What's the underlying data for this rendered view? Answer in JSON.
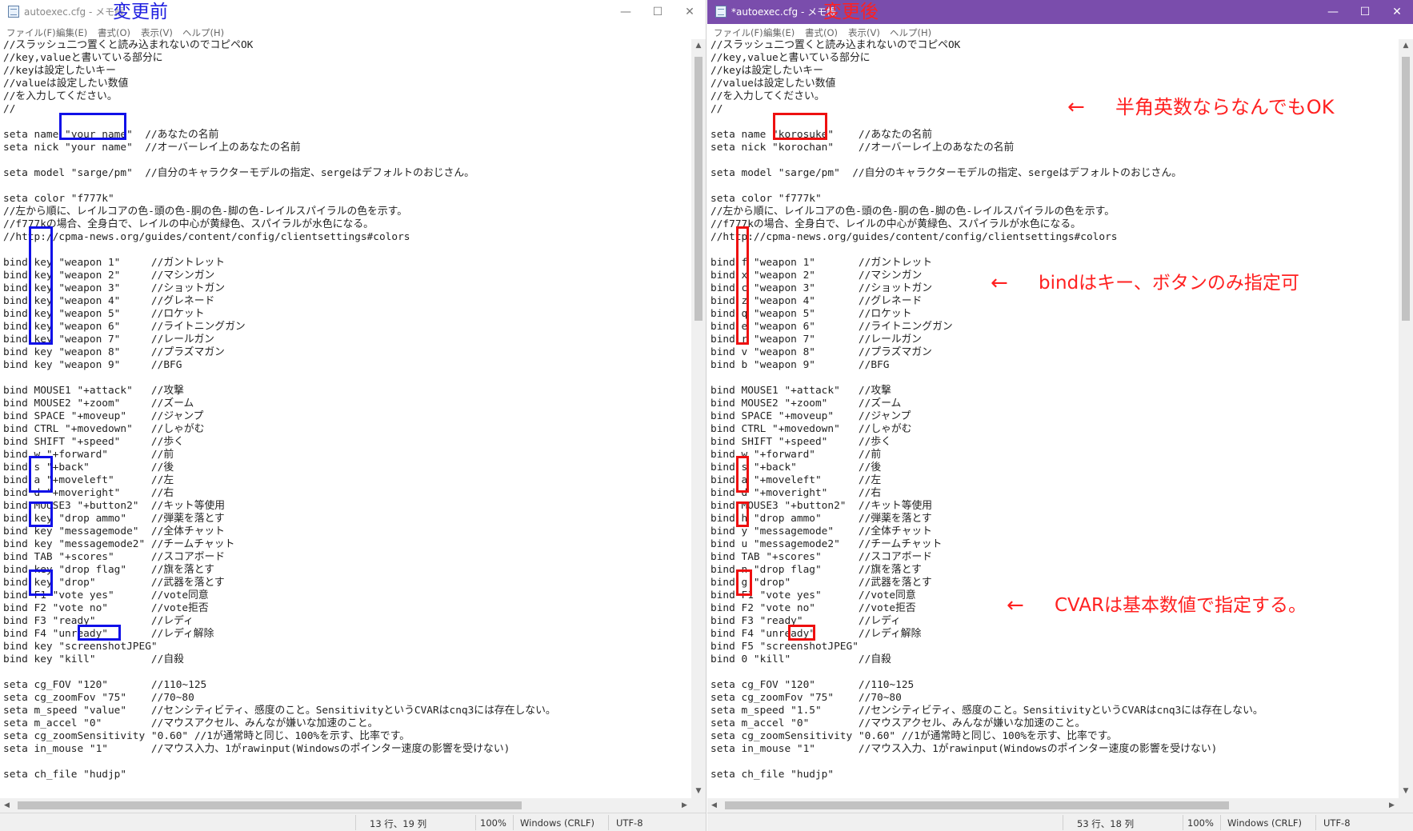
{
  "left_window": {
    "title": "autoexec.cfg - メモ帳",
    "label": "変更前",
    "menu": [
      "ファイル(F)",
      "編集(E)",
      "書式(O)",
      "表示(V)",
      "ヘルプ(H)"
    ],
    "lines": [
      "//スラッシュ二つ置くと読み込まれないのでコピペOK",
      "//key,valueと書いている部分に",
      "//keyは設定したいキー",
      "//valueは設定したい数値",
      "//を入力してください。",
      "//",
      "",
      "seta name \"your name\"  //あなたの名前",
      "seta nick \"your name\"  //オーバーレイ上のあなたの名前",
      "",
      "seta model \"sarge/pm\"  //自分のキャラクターモデルの指定、sergeはデフォルトのおじさん。",
      "",
      "seta color \"f777k\"",
      "//左から順に、レイルコアの色-頭の色-胴の色-脚の色-レイルスパイラルの色を示す。",
      "//f777kの場合、全身白で、レイルの中心が黄緑色、スパイラルが水色になる。",
      "//http://cpma-news.org/guides/content/config/clientsettings#colors",
      "",
      "bind key \"weapon 1\"     //ガントレット",
      "bind key \"weapon 2\"     //マシンガン",
      "bind key \"weapon 3\"     //ショットガン",
      "bind key \"weapon 4\"     //グレネード",
      "bind key \"weapon 5\"     //ロケット",
      "bind key \"weapon 6\"     //ライトニングガン",
      "bind key \"weapon 7\"     //レールガン",
      "bind key \"weapon 8\"     //プラズマガン",
      "bind key \"weapon 9\"     //BFG",
      "",
      "bind MOUSE1 \"+attack\"   //攻撃",
      "bind MOUSE2 \"+zoom\"     //ズーム",
      "bind SPACE \"+moveup\"    //ジャンプ",
      "bind CTRL \"+movedown\"   //しゃがむ",
      "bind SHIFT \"+speed\"     //歩く",
      "bind w \"+forward\"       //前",
      "bind s \"+back\"          //後",
      "bind a \"+moveleft\"      //左",
      "bind d \"+moveright\"     //右",
      "bind MOUSE3 \"+button2\"  //キット等使用",
      "bind key \"drop ammo\"    //弾薬を落とす",
      "bind key \"messagemode\"  //全体チャット",
      "bind key \"messagemode2\" //チームチャット",
      "bind TAB \"+scores\"      //スコアボード",
      "bind key \"drop flag\"    //旗を落とす",
      "bind key \"drop\"         //武器を落とす",
      "bind F1 \"vote yes\"      //vote同意",
      "bind F2 \"vote no\"       //vote拒否",
      "bind F3 \"ready\"         //レディ",
      "bind F4 \"unready\"       //レディ解除",
      "bind key \"screenshotJPEG\"",
      "bind key \"kill\"         //自殺",
      "",
      "seta cg_FOV \"120\"       //110~125",
      "seta cg_zoomFov \"75\"    //70~80",
      "seta m_speed \"value\"    //センシティビティ、感度のこと。SensitivityというCVARはcnq3には存在しない。",
      "seta m_accel \"0\"        //マウスアクセル、みんなが嫌いな加速のこと。",
      "seta cg_zoomSensitivity \"0.60\" //1が通常時と同じ、100%を示す、比率です。",
      "seta in_mouse \"1\"       //マウス入力、1がrawinput(Windowsのポインター速度の影響を受けない)",
      "",
      "seta ch_file \"hudjp\""
    ],
    "status": {
      "position": "13 行、19 列",
      "zoom": "100%",
      "eol": "Windows (CRLF)",
      "encoding": "UTF-8"
    }
  },
  "right_window": {
    "title": "*autoexec.cfg - メモ帳",
    "label": "変更後",
    "menu": [
      "ファイル(F)",
      "編集(E)",
      "書式(O)",
      "表示(V)",
      "ヘルプ(H)"
    ],
    "lines": [
      "//スラッシュ二つ置くと読み込まれないのでコピペOK",
      "//key,valueと書いている部分に",
      "//keyは設定したいキー",
      "//valueは設定したい数値",
      "//を入力してください。",
      "//",
      "",
      "seta name \"korosuke\"    //あなたの名前",
      "seta nick \"korochan\"    //オーバーレイ上のあなたの名前",
      "",
      "seta model \"sarge/pm\"  //自分のキャラクターモデルの指定、sergeはデフォルトのおじさん。",
      "",
      "seta color \"f777k\"",
      "//左から順に、レイルコアの色-頭の色-胴の色-脚の色-レイルスパイラルの色を示す。",
      "//f777kの場合、全身白で、レイルの中心が黄緑色、スパイラルが水色になる。",
      "//http://cpma-news.org/guides/content/config/clientsettings#colors",
      "",
      "bind f \"weapon 1\"       //ガントレット",
      "bind x \"weapon 2\"       //マシンガン",
      "bind c \"weapon 3\"       //ショットガン",
      "bind z \"weapon 4\"       //グレネード",
      "bind q \"weapon 5\"       //ロケット",
      "bind e \"weapon 6\"       //ライトニングガン",
      "bind r \"weapon 7\"       //レールガン",
      "bind v \"weapon 8\"       //プラズマガン",
      "bind b \"weapon 9\"       //BFG",
      "",
      "bind MOUSE1 \"+attack\"   //攻撃",
      "bind MOUSE2 \"+zoom\"     //ズーム",
      "bind SPACE \"+moveup\"    //ジャンプ",
      "bind CTRL \"+movedown\"   //しゃがむ",
      "bind SHIFT \"+speed\"     //歩く",
      "bind w \"+forward\"       //前",
      "bind s \"+back\"          //後",
      "bind a \"+moveleft\"      //左",
      "bind d \"+moveright\"     //右",
      "bind MOUSE3 \"+button2\"  //キット等使用",
      "bind h \"drop ammo\"      //弾薬を落とす",
      "bind y \"messagemode\"    //全体チャット",
      "bind u \"messagemode2\"   //チームチャット",
      "bind TAB \"+scores\"      //スコアボード",
      "bind n \"drop flag\"      //旗を落とす",
      "bind g \"drop\"           //武器を落とす",
      "bind F1 \"vote yes\"      //vote同意",
      "bind F2 \"vote no\"       //vote拒否",
      "bind F3 \"ready\"         //レディ",
      "bind F4 \"unready\"       //レディ解除",
      "bind F5 \"screenshotJPEG\"",
      "bind 0 \"kill\"           //自殺",
      "",
      "seta cg_FOV \"120\"       //110~125",
      "seta cg_zoomFov \"75\"    //70~80",
      "seta m_speed \"1.5\"      //センシティビティ、感度のこと。SensitivityというCVARはcnq3には存在しない。",
      "seta m_accel \"0\"        //マウスアクセル、みんなが嫌いな加速のこと。",
      "seta cg_zoomSensitivity \"0.60\" //1が通常時と同じ、100%を示す、比率です。",
      "seta in_mouse \"1\"       //マウス入力、1がrawinput(Windowsのポインター速度の影響を受けない)",
      "",
      "seta ch_file \"hudjp\""
    ],
    "status": {
      "position": "53 行、18 列",
      "zoom": "100%",
      "eol": "Windows (CRLF)",
      "encoding": "UTF-8"
    }
  },
  "annotations": {
    "name_note": "半角英数ならなんでもOK",
    "bind_note": "bindはキー、ボタンのみ指定可",
    "cvar_note": "CVARは基本数値で指定する。",
    "arrow": "←"
  },
  "colors": {
    "before_accent": "#1010e8",
    "after_accent": "#ee1010",
    "titlebar_active": "#7a4dac"
  }
}
